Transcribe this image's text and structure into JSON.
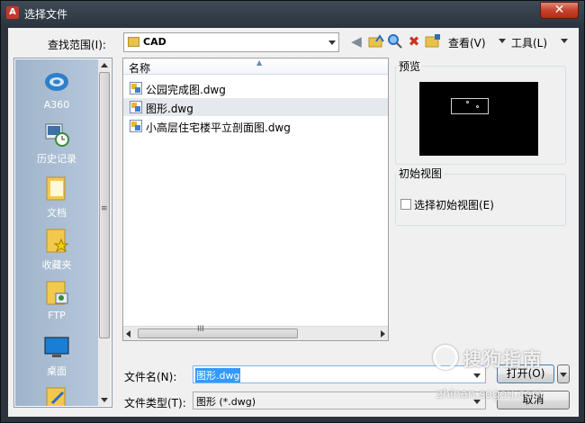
{
  "window": {
    "title": "选择文件",
    "close_glyph": "✕",
    "app_icon_letter": "A"
  },
  "toolbar": {
    "look_in_label": "查找范围(I):",
    "look_in_value": "CAD",
    "icons": [
      "back-arrow-icon",
      "up-folder-icon",
      "search-web-icon",
      "delete-icon",
      "new-folder-icon"
    ],
    "views_label": "查看(V)",
    "tools_label": "工具(L)"
  },
  "places": [
    {
      "label": "A360",
      "icon": "a360-icon"
    },
    {
      "label": "历史记录",
      "icon": "history-icon"
    },
    {
      "label": "文档",
      "icon": "documents-icon"
    },
    {
      "label": "收藏夹",
      "icon": "favorites-icon"
    },
    {
      "label": "FTP",
      "icon": "ftp-icon"
    },
    {
      "label": "桌面",
      "icon": "desktop-icon"
    }
  ],
  "filelist": {
    "column_name": "名称",
    "files": [
      {
        "name": "公园完成图.dwg",
        "selected": false
      },
      {
        "name": "图形.dwg",
        "selected": true
      },
      {
        "name": "小高层住宅楼平立剖面图.dwg",
        "selected": false
      }
    ],
    "hscroll_grip": "III",
    "vscroll_grip": "≡"
  },
  "preview": {
    "label": "预览"
  },
  "initial_view": {
    "label": "初始视图",
    "checkbox_label": "选择初始视图(E)",
    "checked": false
  },
  "bottom": {
    "filename_label": "文件名(N):",
    "filename_value": "图形.dwg",
    "filetype_label": "文件类型(T):",
    "filetype_value": "图形 (*.dwg)",
    "open_button": "打开(O)",
    "cancel_button": "取消"
  },
  "watermark": {
    "text": "搜狗指南",
    "sub": "zhinan.sogou.com"
  },
  "colors": {
    "titlebar": "#2b343d",
    "close": "#c7412c",
    "places_bg": "#a9bcd0",
    "selection": "#3399ff"
  }
}
